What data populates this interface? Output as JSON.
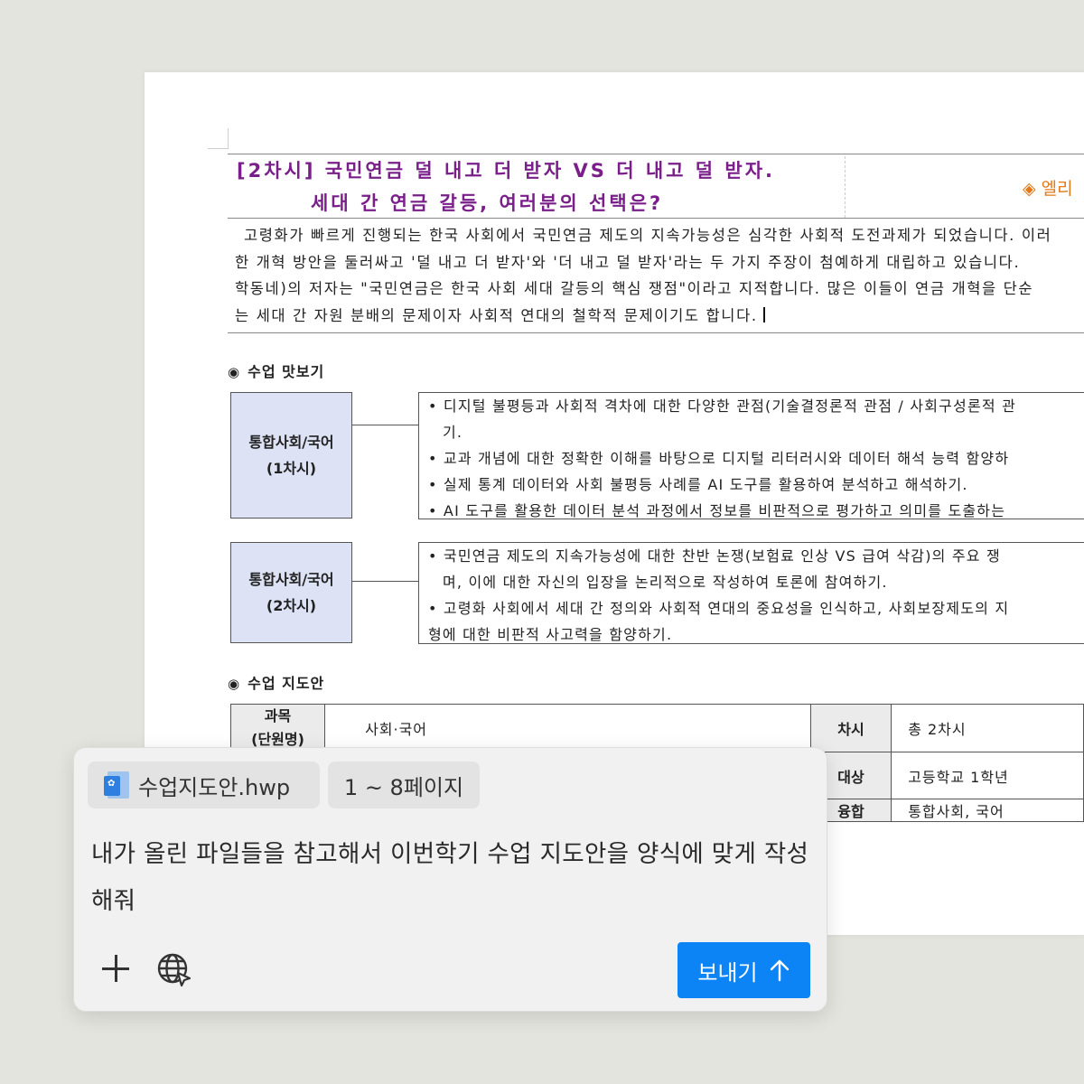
{
  "document": {
    "title_line1": "[2차시] 국민연금 덜 내고 더 받자 VS 더 내고 덜 받자.",
    "title_line2": "세대 간 연금 갈등, 여러분의 선택은?",
    "badge": "◈ 엘리",
    "intro_lines": [
      "고령화가 빠르게 진행되는 한국 사회에서 국민연금 제도의 지속가능성은 심각한 사회적 도전과제가 되었습니다. 이러",
      "한 개혁 방안을 둘러싸고 '덜 내고 더 받자'와 '더 내고 덜 받자'라는 두 가지 주장이 첨예하게 대립하고 있습니다.",
      "학동네)의 저자는 \"국민연금은 한국 사회 세대 갈등의 핵심 쟁점\"이라고 지적합니다. 많은 이들이 연금 개혁을 단순",
      "는 세대 간 자원 분배의 문제이자 사회적 연대의 철학적 문제이기도 합니다."
    ],
    "preview_section": {
      "marker": "◉",
      "label": "수업 맛보기"
    },
    "lesson1": {
      "subject_line1": "통합사회/국어",
      "subject_line2": "(1차시)",
      "goals": [
        "• 디지털 불평등과 사회적 격차에 대한 다양한 관점(기술결정론적 관점 / 사회구성론적 관",
        "기.",
        "• 교과 개념에 대한 정확한 이해를 바탕으로 디지털 리터러시와 데이터 해석 능력 함양하",
        "• 실제 통계 데이터와 사회 불평등 사례를 AI 도구를 활용하여 분석하고 해석하기.",
        "• AI 도구를 활용한 데이터 분석 과정에서 정보를 비판적으로 평가하고 의미를 도출하는"
      ]
    },
    "lesson2": {
      "subject_line1": "통합사회/국어",
      "subject_line2": "(2차시)",
      "goals": [
        "• 국민연금 제도의 지속가능성에 대한 찬반 논쟁(보험료 인상 VS 급여 삭감)의 주요 쟁",
        "며, 이에 대한 자신의 입장을 논리적으로 작성하여 토론에 참여하기.",
        "• 고령화 사회에서 세대 간 정의와 사회적 연대의 중요성을 인식하고, 사회보장제도의 지",
        "형에 대한 비판적 사고력을 함양하기."
      ]
    },
    "plan_section": {
      "marker": "◉",
      "label": "수업 지도안"
    },
    "plan_table": {
      "subject_header_line1": "과목",
      "subject_header_line2": "(단원명)",
      "subject_value": "사회·국어",
      "session_header": "차시",
      "session_value": "총 2차시",
      "target_header": "대상",
      "target_value": "고등학교 1학년",
      "fusion_header": "융합",
      "fusion_value": "통합사회, 국어"
    }
  },
  "chat": {
    "attachment_name": "수업지도안.hwp",
    "attachment_icon": "doc-file-icon",
    "page_range": "1 ~ 8페이지",
    "prompt_text": "내가 올린 파일들을 참고해서 이번학기 수업 지도안을 양식에 맞게 작성해줘",
    "send_label": "보내기",
    "accent_color": "#0d84f5"
  }
}
